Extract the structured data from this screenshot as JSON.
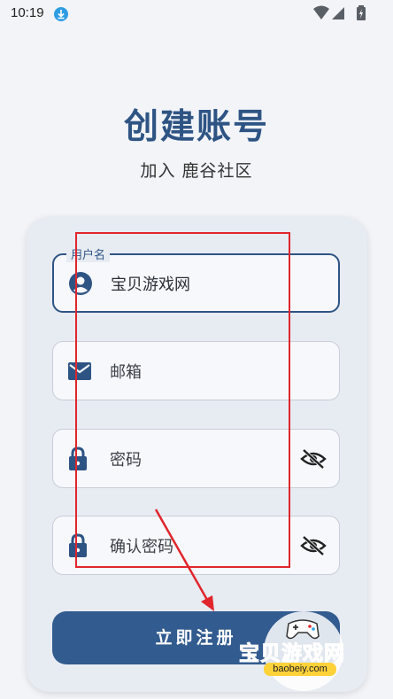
{
  "status_bar": {
    "time": "10:19"
  },
  "header": {
    "title": "创建账号",
    "subtitle": "加入 鹿谷社区"
  },
  "form": {
    "username": {
      "label": "用户名",
      "value": "宝贝游戏网"
    },
    "email": {
      "placeholder": "邮箱"
    },
    "password": {
      "placeholder": "密码"
    },
    "confirm_password": {
      "placeholder": "确认密码"
    },
    "submit_label": "立即注册"
  },
  "watermark": {
    "name": "宝贝游戏网",
    "url": "baobeiy.com"
  },
  "colors": {
    "primary": "#2e5484",
    "button": "#325b8f",
    "annotation": "#e0262c",
    "watermark": "#ff8a1f"
  }
}
